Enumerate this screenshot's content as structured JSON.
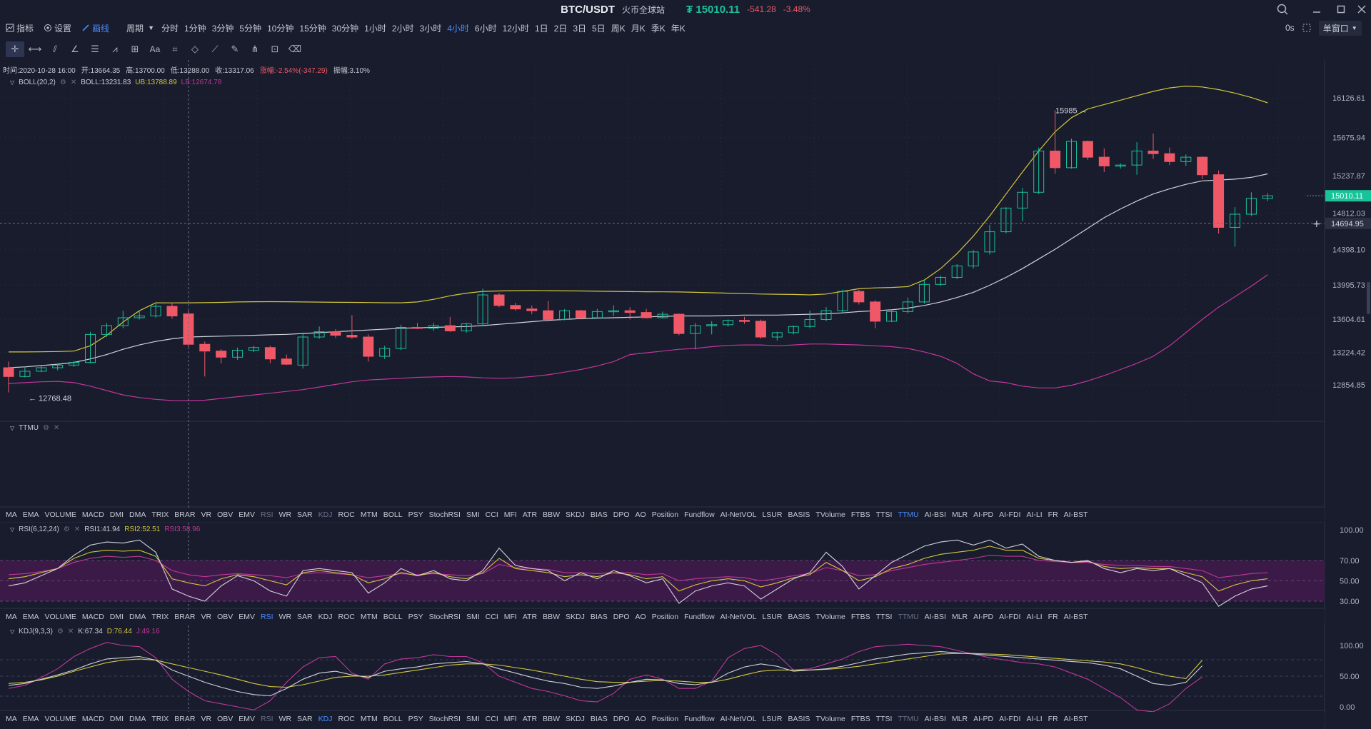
{
  "title": {
    "symbol": "BTC/USDT",
    "exchange": "火币全球站",
    "price": "₮ 15010.11",
    "change": "-541.28",
    "change_pct": "-3.48%"
  },
  "toolbar": {
    "indicators_label": "指标",
    "settings_label": "设置",
    "draw_label": "画线",
    "period_label": "周期",
    "timeframes": [
      "分时",
      "1分钟",
      "3分钟",
      "5分钟",
      "10分钟",
      "15分钟",
      "30分钟",
      "1小时",
      "2小时",
      "3小时",
      "4小时",
      "6小时",
      "12小时",
      "1日",
      "2日",
      "3日",
      "5日",
      "周K",
      "月K",
      "季K",
      "年K"
    ],
    "active_timeframe": "4小时",
    "countdown": "0s",
    "window_mode": "单窗口"
  },
  "drawing_tools": [
    "crosshair",
    "horizontal-line",
    "parallel-lines",
    "angle",
    "fibonacci",
    "trend",
    "rectangle",
    "text",
    "pattern",
    "shape",
    "ruler",
    "brush",
    "magnet",
    "lock",
    "trash"
  ],
  "ohlc": {
    "time": "时间:2020-10-28 16:00",
    "open": "开:13664.35",
    "high": "高:13700.00",
    "low": "低:13288.00",
    "close": "收:13317.06",
    "change": "涨幅:-2.54%(-347.29)",
    "amplitude": "振幅:3.10%"
  },
  "boll": {
    "name": "BOLL(20,2)",
    "mid": "BOLL:13231.83",
    "ub": "UB:13788.89",
    "lb": "LB:12674.78"
  },
  "ttmu": {
    "name": "TTMU"
  },
  "rsi": {
    "name": "RSI(6,12,24)",
    "rsi1": "RSI1:41.94",
    "rsi2": "RSI2:52.51",
    "rsi3": "RSI3:58.96"
  },
  "kdj": {
    "name": "KDJ(9,3,3)",
    "k": "K:67.34",
    "d": "D:76.44",
    "j": "J:49.16"
  },
  "indicator_tabs": [
    "MA",
    "EMA",
    "VOLUME",
    "MACD",
    "DMI",
    "DMA",
    "TRIX",
    "BRAR",
    "VR",
    "OBV",
    "EMV",
    "RSI",
    "WR",
    "SAR",
    "KDJ",
    "ROC",
    "MTM",
    "BOLL",
    "PSY",
    "StochRSI",
    "SMI",
    "CCI",
    "MFI",
    "ATR",
    "BBW",
    "SKDJ",
    "BIAS",
    "DPO",
    "AO",
    "Position",
    "Fundflow",
    "AI-NetVOL",
    "LSUR",
    "BASIS",
    "TVolume",
    "FTBS",
    "TTSI",
    "TTMU",
    "AI-BSI",
    "MLR",
    "AI-PD",
    "AI-FDI",
    "AI-LI",
    "FR",
    "AI-BST"
  ],
  "tab_bar_1": {
    "active": "TTMU",
    "dim": [
      "RSI",
      "KDJ"
    ]
  },
  "tab_bar_2": {
    "active": "RSI",
    "dim": [
      "TTMU"
    ]
  },
  "tab_bar_3": {
    "active": "KDJ",
    "dim": [
      "RSI",
      "TTMU"
    ]
  },
  "price_axis": [
    "16126.61",
    "15675.94",
    "15237.87",
    "14812.03",
    "14398.10",
    "13995.73",
    "13604.61",
    "13224.42",
    "12854.85"
  ],
  "rsi_axis": [
    "100.00",
    "70.00",
    "50.00",
    "30.00"
  ],
  "kdj_axis": [
    "100.00",
    "50.00",
    "0.00"
  ],
  "current_price_tag": "15010.11",
  "crosshair_price_tag": "14694.95",
  "annotations": {
    "high_label": "15985 →",
    "low_label": "← 12768.48"
  },
  "colors": {
    "up": "#18c39a",
    "down": "#f05868",
    "boll_mid": "#d0d3dc",
    "boll_ub": "#d4c73e",
    "boll_lb": "#c0379b",
    "rsi_band": "#3b1a48",
    "accent": "#4a8cff"
  },
  "chart_data": {
    "type": "candlestick",
    "interval": "4小时",
    "candles": [
      {
        "o": 13050,
        "h": 13120,
        "l": 12768,
        "c": 12950
      },
      {
        "o": 12950,
        "h": 13060,
        "l": 12940,
        "c": 13010
      },
      {
        "o": 13010,
        "h": 13070,
        "l": 13000,
        "c": 13050
      },
      {
        "o": 13050,
        "h": 13100,
        "l": 13020,
        "c": 13080
      },
      {
        "o": 13080,
        "h": 13130,
        "l": 13060,
        "c": 13110
      },
      {
        "o": 13110,
        "h": 13460,
        "l": 13100,
        "c": 13430
      },
      {
        "o": 13430,
        "h": 13560,
        "l": 13400,
        "c": 13530
      },
      {
        "o": 13530,
        "h": 13700,
        "l": 13500,
        "c": 13620
      },
      {
        "o": 13620,
        "h": 13700,
        "l": 13600,
        "c": 13640
      },
      {
        "o": 13640,
        "h": 13780,
        "l": 13620,
        "c": 13750
      },
      {
        "o": 13750,
        "h": 13790,
        "l": 13610,
        "c": 13640
      },
      {
        "o": 13664,
        "h": 13700,
        "l": 13288,
        "c": 13317
      },
      {
        "o": 13317,
        "h": 13350,
        "l": 12950,
        "c": 13240
      },
      {
        "o": 13240,
        "h": 13260,
        "l": 13100,
        "c": 13170
      },
      {
        "o": 13170,
        "h": 13280,
        "l": 13140,
        "c": 13250
      },
      {
        "o": 13250,
        "h": 13300,
        "l": 13230,
        "c": 13280
      },
      {
        "o": 13280,
        "h": 13300,
        "l": 13100,
        "c": 13150
      },
      {
        "o": 13150,
        "h": 13200,
        "l": 13080,
        "c": 13090
      },
      {
        "o": 13080,
        "h": 13450,
        "l": 13040,
        "c": 13400
      },
      {
        "o": 13400,
        "h": 13520,
        "l": 13380,
        "c": 13460
      },
      {
        "o": 13460,
        "h": 13490,
        "l": 13390,
        "c": 13420
      },
      {
        "o": 13420,
        "h": 13650,
        "l": 13380,
        "c": 13400
      },
      {
        "o": 13400,
        "h": 13430,
        "l": 13120,
        "c": 13180
      },
      {
        "o": 13180,
        "h": 13300,
        "l": 13150,
        "c": 13270
      },
      {
        "o": 13270,
        "h": 13540,
        "l": 13250,
        "c": 13510
      },
      {
        "o": 13510,
        "h": 13560,
        "l": 13490,
        "c": 13500
      },
      {
        "o": 13500,
        "h": 13560,
        "l": 13470,
        "c": 13530
      },
      {
        "o": 13530,
        "h": 13630,
        "l": 13460,
        "c": 13470
      },
      {
        "o": 13470,
        "h": 13560,
        "l": 13450,
        "c": 13550
      },
      {
        "o": 13550,
        "h": 13950,
        "l": 13530,
        "c": 13880
      },
      {
        "o": 13880,
        "h": 13900,
        "l": 13740,
        "c": 13760
      },
      {
        "o": 13760,
        "h": 13790,
        "l": 13700,
        "c": 13720
      },
      {
        "o": 13720,
        "h": 13760,
        "l": 13660,
        "c": 13700
      },
      {
        "o": 13700,
        "h": 13810,
        "l": 13580,
        "c": 13600
      },
      {
        "o": 13600,
        "h": 13720,
        "l": 13590,
        "c": 13700
      },
      {
        "o": 13700,
        "h": 13710,
        "l": 13600,
        "c": 13620
      },
      {
        "o": 13620,
        "h": 13720,
        "l": 13610,
        "c": 13690
      },
      {
        "o": 13690,
        "h": 13760,
        "l": 13640,
        "c": 13700
      },
      {
        "o": 13700,
        "h": 13740,
        "l": 13600,
        "c": 13680
      },
      {
        "o": 13680,
        "h": 13720,
        "l": 13610,
        "c": 13620
      },
      {
        "o": 13620,
        "h": 13690,
        "l": 13610,
        "c": 13660
      },
      {
        "o": 13660,
        "h": 13670,
        "l": 13420,
        "c": 13440
      },
      {
        "o": 13440,
        "h": 13560,
        "l": 13260,
        "c": 13530
      },
      {
        "o": 13530,
        "h": 13580,
        "l": 13430,
        "c": 13540
      },
      {
        "o": 13540,
        "h": 13600,
        "l": 13520,
        "c": 13590
      },
      {
        "o": 13590,
        "h": 13630,
        "l": 13550,
        "c": 13580
      },
      {
        "o": 13580,
        "h": 13600,
        "l": 13380,
        "c": 13400
      },
      {
        "o": 13400,
        "h": 13460,
        "l": 13360,
        "c": 13450
      },
      {
        "o": 13450,
        "h": 13530,
        "l": 13430,
        "c": 13520
      },
      {
        "o": 13520,
        "h": 13700,
        "l": 13500,
        "c": 13600
      },
      {
        "o": 13600,
        "h": 13740,
        "l": 13580,
        "c": 13700
      },
      {
        "o": 13700,
        "h": 13940,
        "l": 13680,
        "c": 13920
      },
      {
        "o": 13920,
        "h": 13940,
        "l": 13770,
        "c": 13800
      },
      {
        "o": 13800,
        "h": 13820,
        "l": 13500,
        "c": 13580
      },
      {
        "o": 13580,
        "h": 13710,
        "l": 13570,
        "c": 13690
      },
      {
        "o": 13690,
        "h": 13850,
        "l": 13670,
        "c": 13800
      },
      {
        "o": 13800,
        "h": 14050,
        "l": 13780,
        "c": 14000
      },
      {
        "o": 14000,
        "h": 14100,
        "l": 13980,
        "c": 14080
      },
      {
        "o": 14080,
        "h": 14230,
        "l": 14060,
        "c": 14210
      },
      {
        "o": 14210,
        "h": 14390,
        "l": 14180,
        "c": 14370
      },
      {
        "o": 14370,
        "h": 14680,
        "l": 14340,
        "c": 14600
      },
      {
        "o": 14600,
        "h": 14880,
        "l": 14580,
        "c": 14870
      },
      {
        "o": 14870,
        "h": 15100,
        "l": 14720,
        "c": 15050
      },
      {
        "o": 15050,
        "h": 15560,
        "l": 15030,
        "c": 15520
      },
      {
        "o": 15520,
        "h": 15985,
        "l": 15260,
        "c": 15330
      },
      {
        "o": 15330,
        "h": 15660,
        "l": 15320,
        "c": 15630
      },
      {
        "o": 15630,
        "h": 15640,
        "l": 15420,
        "c": 15450
      },
      {
        "o": 15450,
        "h": 15550,
        "l": 15280,
        "c": 15350
      },
      {
        "o": 15350,
        "h": 15380,
        "l": 15320,
        "c": 15360
      },
      {
        "o": 15360,
        "h": 15620,
        "l": 15250,
        "c": 15520
      },
      {
        "o": 15520,
        "h": 15720,
        "l": 15430,
        "c": 15490
      },
      {
        "o": 15490,
        "h": 15560,
        "l": 15360,
        "c": 15400
      },
      {
        "o": 15400,
        "h": 15480,
        "l": 15350,
        "c": 15450
      },
      {
        "o": 15450,
        "h": 15460,
        "l": 15200,
        "c": 15250
      },
      {
        "o": 15250,
        "h": 15300,
        "l": 14580,
        "c": 14650
      },
      {
        "o": 14650,
        "h": 14880,
        "l": 14430,
        "c": 14800
      },
      {
        "o": 14800,
        "h": 15050,
        "l": 14780,
        "c": 14980
      },
      {
        "o": 14980,
        "h": 15040,
        "l": 14950,
        "c": 15010
      }
    ],
    "boll_mid": [
      13050,
      13060,
      13075,
      13090,
      13110,
      13150,
      13200,
      13260,
      13310,
      13350,
      13380,
      13400,
      13405,
      13410,
      13415,
      13420,
      13425,
      13430,
      13440,
      13450,
      13460,
      13470,
      13480,
      13490,
      13500,
      13505,
      13510,
      13515,
      13520,
      13530,
      13545,
      13560,
      13575,
      13590,
      13600,
      13610,
      13615,
      13620,
      13625,
      13630,
      13635,
      13640,
      13640,
      13640,
      13645,
      13650,
      13650,
      13650,
      13655,
      13660,
      13665,
      13675,
      13690,
      13700,
      13710,
      13730,
      13760,
      13800,
      13850,
      13910,
      13990,
      14080,
      14180,
      14290,
      14400,
      14520,
      14640,
      14760,
      14860,
      14950,
      15030,
      15090,
      15140,
      15180,
      15190,
      15200,
      15220,
      15260
    ],
    "boll_ub": [
      13230,
      13230,
      13232,
      13235,
      13240,
      13300,
      13420,
      13570,
      13700,
      13790,
      13789,
      13790,
      13792,
      13795,
      13800,
      13802,
      13803,
      13802,
      13800,
      13798,
      13796,
      13795,
      13793,
      13791,
      13790,
      13800,
      13830,
      13870,
      13900,
      13920,
      13925,
      13928,
      13930,
      13928,
      13926,
      13925,
      13922,
      13920,
      13918,
      13916,
      13915,
      13914,
      13910,
      13905,
      13900,
      13895,
      13890,
      13888,
      13885,
      13880,
      13890,
      13920,
      13950,
      13960,
      13965,
      13975,
      14050,
      14180,
      14350,
      14550,
      14780,
      15030,
      15280,
      15520,
      15740,
      15900,
      16000,
      16050,
      16100,
      16150,
      16200,
      16240,
      16260,
      16250,
      16220,
      16180,
      16130,
      16070
    ],
    "boll_lb": [
      12870,
      12880,
      12890,
      12895,
      12880,
      12840,
      12790,
      12740,
      12710,
      12690,
      12676,
      12675,
      12680,
      12700,
      12720,
      12740,
      12760,
      12780,
      12800,
      12830,
      12860,
      12890,
      12910,
      12920,
      12930,
      12940,
      12945,
      12950,
      12945,
      12935,
      12930,
      12935,
      12950,
      12970,
      13000,
      13030,
      13070,
      13120,
      13200,
      13220,
      13240,
      13260,
      13270,
      13290,
      13305,
      13310,
      13310,
      13300,
      13310,
      13320,
      13320,
      13315,
      13310,
      13300,
      13290,
      13270,
      13230,
      13180,
      13100,
      12980,
      12900,
      12880,
      12840,
      12820,
      12820,
      12850,
      12900,
      12960,
      13030,
      13100,
      13180,
      13300,
      13450,
      13600,
      13740,
      13860,
      13980,
      14110
    ],
    "rsi1": [
      45,
      48,
      55,
      62,
      75,
      85,
      88,
      87,
      90,
      78,
      42,
      35,
      30,
      45,
      55,
      50,
      40,
      35,
      60,
      62,
      60,
      58,
      38,
      48,
      62,
      55,
      60,
      52,
      50,
      60,
      82,
      65,
      62,
      60,
      50,
      58,
      52,
      60,
      55,
      48,
      52,
      28,
      40,
      45,
      48,
      45,
      32,
      42,
      52,
      58,
      78,
      64,
      42,
      55,
      68,
      76,
      84,
      88,
      90,
      85,
      90,
      82,
      86,
      74,
      70,
      68,
      70,
      62,
      58,
      62,
      60,
      62,
      55,
      48,
      25,
      35,
      42,
      45
    ],
    "rsi2": [
      52,
      54,
      58,
      62,
      72,
      78,
      80,
      79,
      80,
      74,
      52,
      48,
      45,
      52,
      56,
      54,
      50,
      46,
      58,
      60,
      58,
      56,
      48,
      52,
      58,
      55,
      58,
      54,
      52,
      58,
      72,
      62,
      60,
      58,
      54,
      56,
      54,
      58,
      56,
      52,
      54,
      40,
      46,
      50,
      52,
      50,
      44,
      48,
      53,
      56,
      68,
      60,
      50,
      54,
      62,
      66,
      72,
      76,
      78,
      80,
      84,
      80,
      80,
      72,
      70,
      68,
      69,
      64,
      62,
      63,
      62,
      62,
      58,
      54,
      40,
      46,
      50,
      52
    ],
    "rsi3": [
      56,
      57,
      59,
      62,
      68,
      72,
      74,
      73,
      74,
      70,
      60,
      56,
      54,
      56,
      57,
      56,
      55,
      53,
      57,
      58,
      57,
      56,
      53,
      55,
      57,
      56,
      57,
      56,
      55,
      57,
      66,
      63,
      62,
      61,
      58,
      58,
      57,
      58,
      58,
      56,
      57,
      50,
      52,
      53,
      54,
      53,
      50,
      52,
      55,
      57,
      63,
      60,
      55,
      56,
      60,
      63,
      66,
      68,
      70,
      72,
      75,
      74,
      74,
      70,
      69,
      68,
      68,
      66,
      65,
      65,
      64,
      64,
      62,
      60,
      53,
      55,
      57,
      58
    ],
    "kdj_k": [
      35,
      38,
      45,
      52,
      60,
      70,
      78,
      80,
      82,
      76,
      60,
      50,
      40,
      32,
      25,
      20,
      18,
      30,
      45,
      55,
      58,
      52,
      48,
      58,
      62,
      65,
      70,
      72,
      74,
      70,
      62,
      55,
      48,
      42,
      38,
      32,
      30,
      34,
      40,
      45,
      44,
      38,
      36,
      40,
      55,
      65,
      70,
      66,
      58,
      60,
      62,
      66,
      72,
      78,
      82,
      86,
      88,
      90,
      88,
      86,
      84,
      82,
      80,
      78,
      76,
      74,
      72,
      68,
      62,
      50,
      38,
      35,
      40,
      67
    ],
    "kdj_d": [
      38,
      40,
      44,
      50,
      58,
      65,
      72,
      76,
      78,
      76,
      70,
      64,
      58,
      52,
      45,
      38,
      33,
      32,
      36,
      42,
      48,
      50,
      50,
      52,
      56,
      60,
      64,
      68,
      70,
      70,
      68,
      64,
      60,
      55,
      50,
      45,
      41,
      40,
      40,
      42,
      43,
      42,
      40,
      40,
      45,
      52,
      58,
      60,
      60,
      60,
      61,
      63,
      66,
      70,
      74,
      78,
      82,
      86,
      87,
      87,
      86,
      85,
      83,
      81,
      79,
      77,
      75,
      73,
      70,
      64,
      56,
      50,
      46,
      76
    ],
    "kdj_j": [
      30,
      35,
      48,
      62,
      82,
      95,
      105,
      100,
      98,
      80,
      45,
      25,
      10,
      5,
      0,
      -5,
      10,
      40,
      65,
      80,
      82,
      55,
      45,
      70,
      78,
      80,
      85,
      82,
      82,
      72,
      50,
      40,
      30,
      25,
      18,
      10,
      8,
      22,
      45,
      52,
      45,
      30,
      30,
      42,
      80,
      95,
      100,
      85,
      60,
      62,
      70,
      78,
      90,
      98,
      100,
      102,
      100,
      98,
      92,
      86,
      80,
      76,
      72,
      70,
      65,
      55,
      45,
      30,
      15,
      -5,
      -8,
      5,
      30,
      49
    ]
  }
}
